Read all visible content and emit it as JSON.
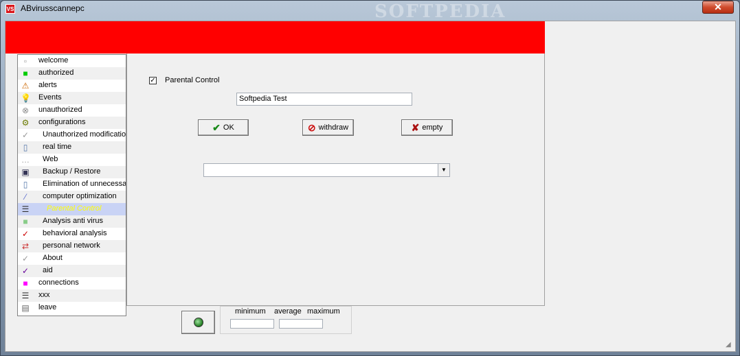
{
  "window": {
    "title": "ABvirusscannepc",
    "logo_text": "VS",
    "watermark": "SOFTPEDIA",
    "close_glyph": "✕"
  },
  "sidebar": {
    "items": [
      {
        "label": "welcome",
        "icon": "info-icon",
        "glyph": "▫",
        "color": "#999999"
      },
      {
        "label": "authorized",
        "icon": "green-square-icon",
        "glyph": "■",
        "color": "#00cc00"
      },
      {
        "label": "alerts",
        "icon": "alert-icon",
        "glyph": "⚠",
        "color": "#cc6600"
      },
      {
        "label": "Events",
        "icon": "lightbulb-icon",
        "glyph": "💡",
        "color": "#cccc00"
      },
      {
        "label": "unauthorized",
        "icon": "block-icon",
        "glyph": "⊗",
        "color": "#888888"
      },
      {
        "label": "configurations",
        "icon": "config-icon",
        "glyph": "⚙",
        "color": "#6b7a00"
      },
      {
        "label": "Unauthorized modifications",
        "icon": "check-icon",
        "glyph": "✓",
        "color": "#999999"
      },
      {
        "label": "real time",
        "icon": "page-icon",
        "glyph": "▯",
        "color": "#5577aa"
      },
      {
        "label": "Web",
        "icon": "web-icon",
        "glyph": "…",
        "color": "#999999"
      },
      {
        "label": "Backup / Restore",
        "icon": "backup-icon",
        "glyph": "▣",
        "color": "#333355"
      },
      {
        "label": "Elimination of unnecessary files",
        "icon": "page-icon",
        "glyph": "▯",
        "color": "#5577aa"
      },
      {
        "label": "computer optimization",
        "icon": "wand-icon",
        "glyph": "⁄",
        "color": "#5566cc"
      },
      {
        "label": "Parental Control",
        "icon": "list-icon",
        "glyph": "☰",
        "color": "#333333"
      },
      {
        "label": "Analysis anti virus",
        "icon": "green-box-icon",
        "glyph": "■",
        "color": "#88cc88"
      },
      {
        "label": "behavioral analysis",
        "icon": "check-red-icon",
        "glyph": "✓",
        "color": "#cc0000"
      },
      {
        "label": "personal network",
        "icon": "network-icon",
        "glyph": "⇄",
        "color": "#cc3333"
      },
      {
        "label": "About",
        "icon": "check-icon",
        "glyph": "✓",
        "color": "#999999"
      },
      {
        "label": "aid",
        "icon": "check-purple-icon",
        "glyph": "✓",
        "color": "#660099"
      },
      {
        "label": "connections",
        "icon": "magenta-square-icon",
        "glyph": "■",
        "color": "#ff00ff"
      },
      {
        "label": "xxx",
        "icon": "list-icon",
        "glyph": "☰",
        "color": "#333333"
      },
      {
        "label": "leave",
        "icon": "exit-icon",
        "glyph": "▤",
        "color": "#666666"
      }
    ]
  },
  "main": {
    "parental_control_label": "Parental Control",
    "parental_control_checked": "✓",
    "name_value": "Softpedia Test",
    "ok_label": "OK",
    "withdraw_label": "withdraw",
    "empty_label": "empty",
    "dropdown_value": "",
    "dropdown_arrow": "▼"
  },
  "stats": {
    "minimum_label": "minimum",
    "average_label": "average",
    "maximum_label": "maximum"
  }
}
